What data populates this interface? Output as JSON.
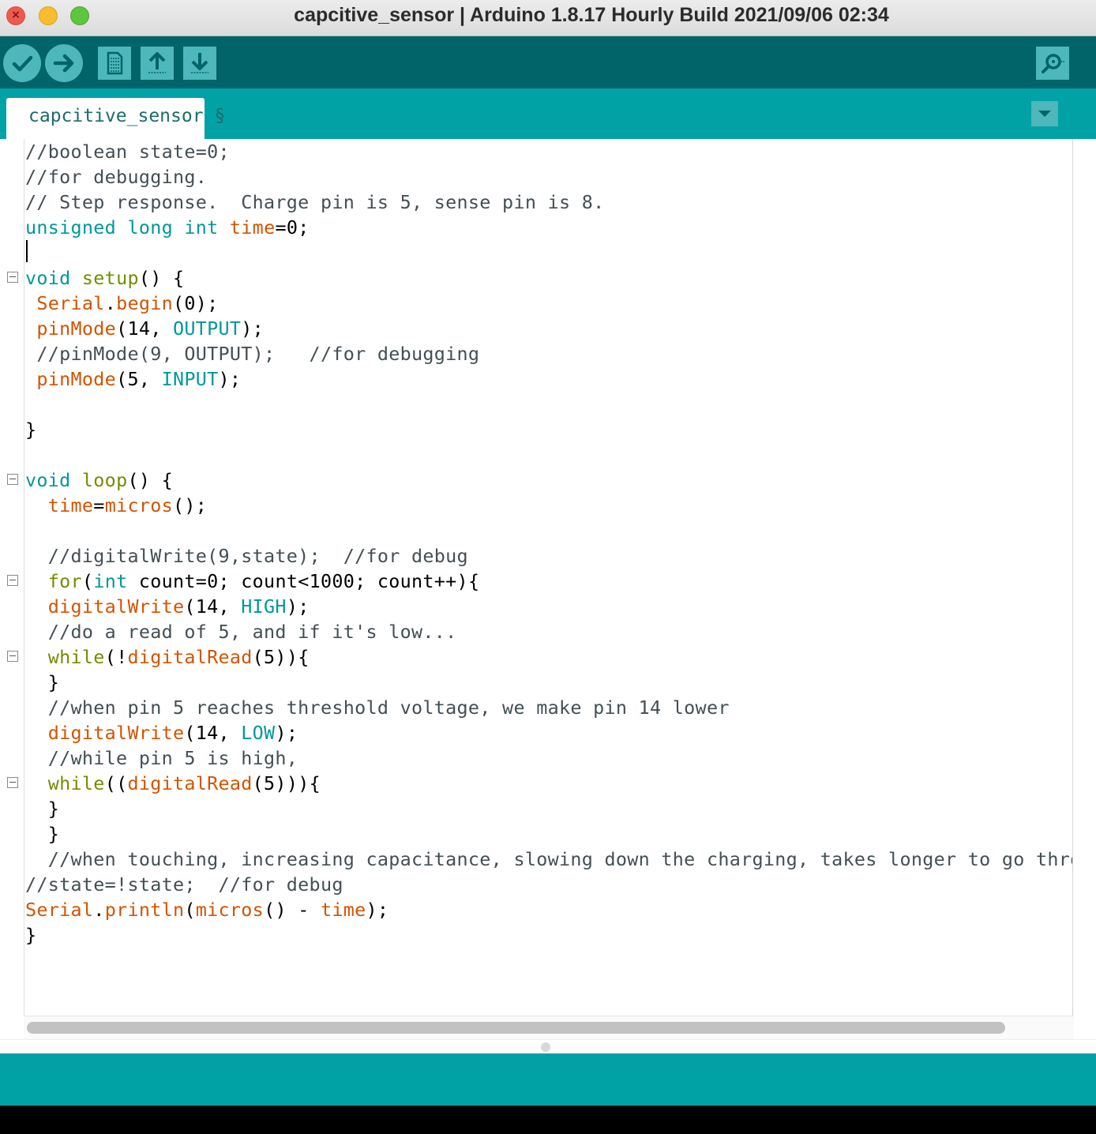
{
  "window": {
    "title": "capcitive_sensor | Arduino 1.8.17 Hourly Build 2021/09/06 02:34",
    "close_glyph": "×"
  },
  "toolbar": {
    "buttons": [
      {
        "name": "verify",
        "icon": "check-icon"
      },
      {
        "name": "upload",
        "icon": "arrow-right-icon"
      },
      {
        "name": "new",
        "icon": "new-file-icon"
      },
      {
        "name": "open",
        "icon": "arrow-up-icon"
      },
      {
        "name": "save",
        "icon": "arrow-down-icon"
      },
      {
        "name": "serial-monitor",
        "icon": "magnifier-icon"
      }
    ]
  },
  "tabs": [
    {
      "label": "capcitive_sensor §"
    }
  ],
  "colors": {
    "keyword": "#00979c",
    "function": "#d35400",
    "type": "#00979c",
    "flow": "#728e00",
    "comment": "#434f54",
    "default": "#000000",
    "toolbar": "#006468",
    "accent": "#00a2a6"
  },
  "code": {
    "lines": [
      {
        "fold": false,
        "tokens": [
          {
            "t": "//boolean state=0;",
            "c": "comment"
          }
        ]
      },
      {
        "fold": false,
        "tokens": [
          {
            "t": "//for debugging.",
            "c": "comment"
          }
        ]
      },
      {
        "fold": false,
        "tokens": [
          {
            "t": "// Step response.  Charge pin is 5, sense pin is 8.",
            "c": "comment"
          }
        ]
      },
      {
        "fold": false,
        "tokens": [
          {
            "t": "unsigned",
            "c": "keyword"
          },
          {
            "t": " ",
            "c": "default"
          },
          {
            "t": "long",
            "c": "keyword"
          },
          {
            "t": " ",
            "c": "default"
          },
          {
            "t": "int",
            "c": "keyword"
          },
          {
            "t": " ",
            "c": "default"
          },
          {
            "t": "time",
            "c": "function"
          },
          {
            "t": "=0;",
            "c": "default"
          }
        ]
      },
      {
        "fold": false,
        "tokens": [
          {
            "t": "",
            "c": "default"
          }
        ]
      },
      {
        "fold": true,
        "tokens": [
          {
            "t": "void",
            "c": "keyword"
          },
          {
            "t": " ",
            "c": "default"
          },
          {
            "t": "setup",
            "c": "flow"
          },
          {
            "t": "() {",
            "c": "default"
          }
        ]
      },
      {
        "fold": false,
        "tokens": [
          {
            "t": " ",
            "c": "default"
          },
          {
            "t": "Serial",
            "c": "function"
          },
          {
            "t": ".",
            "c": "default"
          },
          {
            "t": "begin",
            "c": "function"
          },
          {
            "t": "(0);",
            "c": "default"
          }
        ]
      },
      {
        "fold": false,
        "tokens": [
          {
            "t": " ",
            "c": "default"
          },
          {
            "t": "pinMode",
            "c": "function"
          },
          {
            "t": "(14, ",
            "c": "default"
          },
          {
            "t": "OUTPUT",
            "c": "keyword"
          },
          {
            "t": ");",
            "c": "default"
          }
        ]
      },
      {
        "fold": false,
        "tokens": [
          {
            "t": " //pinMode(9, OUTPUT);   //for debugging",
            "c": "comment"
          }
        ]
      },
      {
        "fold": false,
        "tokens": [
          {
            "t": " ",
            "c": "default"
          },
          {
            "t": "pinMode",
            "c": "function"
          },
          {
            "t": "(5, ",
            "c": "default"
          },
          {
            "t": "INPUT",
            "c": "keyword"
          },
          {
            "t": ");",
            "c": "default"
          }
        ]
      },
      {
        "fold": false,
        "tokens": [
          {
            "t": "",
            "c": "default"
          }
        ]
      },
      {
        "fold": false,
        "tokens": [
          {
            "t": "}",
            "c": "default"
          }
        ]
      },
      {
        "fold": false,
        "tokens": [
          {
            "t": "",
            "c": "default"
          }
        ]
      },
      {
        "fold": true,
        "tokens": [
          {
            "t": "void",
            "c": "keyword"
          },
          {
            "t": " ",
            "c": "default"
          },
          {
            "t": "loop",
            "c": "flow"
          },
          {
            "t": "() {",
            "c": "default"
          }
        ]
      },
      {
        "fold": false,
        "tokens": [
          {
            "t": "  ",
            "c": "default"
          },
          {
            "t": "time",
            "c": "function"
          },
          {
            "t": "=",
            "c": "default"
          },
          {
            "t": "micros",
            "c": "function"
          },
          {
            "t": "();",
            "c": "default"
          }
        ]
      },
      {
        "fold": false,
        "tokens": [
          {
            "t": "",
            "c": "default"
          }
        ]
      },
      {
        "fold": false,
        "tokens": [
          {
            "t": "  //digitalWrite(9,state);  //for debug",
            "c": "comment"
          }
        ]
      },
      {
        "fold": true,
        "tokens": [
          {
            "t": "  ",
            "c": "default"
          },
          {
            "t": "for",
            "c": "flow"
          },
          {
            "t": "(",
            "c": "default"
          },
          {
            "t": "int",
            "c": "keyword"
          },
          {
            "t": " count=0; count<1000; count++){",
            "c": "default"
          }
        ]
      },
      {
        "fold": false,
        "tokens": [
          {
            "t": "  ",
            "c": "default"
          },
          {
            "t": "digitalWrite",
            "c": "function"
          },
          {
            "t": "(14, ",
            "c": "default"
          },
          {
            "t": "HIGH",
            "c": "keyword"
          },
          {
            "t": ");",
            "c": "default"
          }
        ]
      },
      {
        "fold": false,
        "tokens": [
          {
            "t": "  //do a read of 5, and if it's low...",
            "c": "comment"
          }
        ]
      },
      {
        "fold": true,
        "tokens": [
          {
            "t": "  ",
            "c": "default"
          },
          {
            "t": "while",
            "c": "flow"
          },
          {
            "t": "(!",
            "c": "default"
          },
          {
            "t": "digitalRead",
            "c": "function"
          },
          {
            "t": "(5)){",
            "c": "default"
          }
        ]
      },
      {
        "fold": false,
        "tokens": [
          {
            "t": "  }",
            "c": "default"
          }
        ]
      },
      {
        "fold": false,
        "tokens": [
          {
            "t": "  //when pin 5 reaches threshold voltage, we make pin 14 lower",
            "c": "comment"
          }
        ]
      },
      {
        "fold": false,
        "tokens": [
          {
            "t": "  ",
            "c": "default"
          },
          {
            "t": "digitalWrite",
            "c": "function"
          },
          {
            "t": "(14, ",
            "c": "default"
          },
          {
            "t": "LOW",
            "c": "keyword"
          },
          {
            "t": ");",
            "c": "default"
          }
        ]
      },
      {
        "fold": false,
        "tokens": [
          {
            "t": "  //while pin 5 is high,",
            "c": "comment"
          }
        ]
      },
      {
        "fold": true,
        "tokens": [
          {
            "t": "  ",
            "c": "default"
          },
          {
            "t": "while",
            "c": "flow"
          },
          {
            "t": "((",
            "c": "default"
          },
          {
            "t": "digitalRead",
            "c": "function"
          },
          {
            "t": "(5))){",
            "c": "default"
          }
        ]
      },
      {
        "fold": false,
        "tokens": [
          {
            "t": "  }",
            "c": "default"
          }
        ]
      },
      {
        "fold": false,
        "tokens": [
          {
            "t": "  }",
            "c": "default"
          }
        ]
      },
      {
        "fold": false,
        "tokens": [
          {
            "t": "  //when touching, increasing capacitance, slowing down the charging, takes longer to go throug",
            "c": "comment"
          }
        ]
      },
      {
        "fold": false,
        "tokens": [
          {
            "t": "//state=!state;  //for debug",
            "c": "comment"
          }
        ]
      },
      {
        "fold": false,
        "tokens": [
          {
            "t": "Serial",
            "c": "function"
          },
          {
            "t": ".",
            "c": "default"
          },
          {
            "t": "println",
            "c": "function"
          },
          {
            "t": "(",
            "c": "default"
          },
          {
            "t": "micros",
            "c": "function"
          },
          {
            "t": "() - ",
            "c": "default"
          },
          {
            "t": "time",
            "c": "function"
          },
          {
            "t": ");",
            "c": "default"
          }
        ]
      },
      {
        "fold": false,
        "tokens": [
          {
            "t": "}",
            "c": "default"
          }
        ]
      }
    ]
  }
}
